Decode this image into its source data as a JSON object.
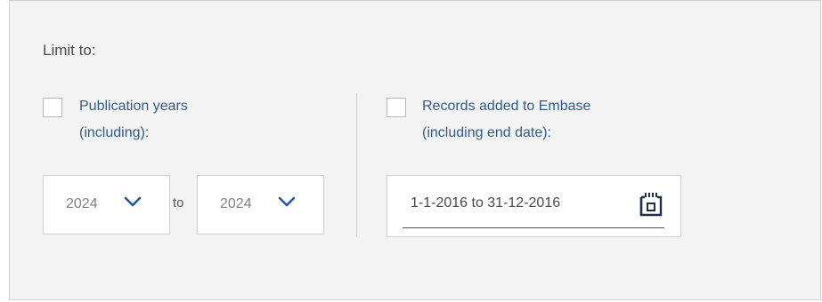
{
  "limit": {
    "title": "Limit to:"
  },
  "publication_years": {
    "label_line1": "Publication years",
    "label_line2": "(including):",
    "checked": false,
    "from_value": "2024",
    "to_label": "to",
    "to_value": "2024",
    "chevron_icon": "chevron-down-icon"
  },
  "records_added": {
    "label_line1": "Records added to Embase",
    "label_line2": "(including end date):",
    "checked": false,
    "date_range_value": "1-1-2016 to 31-12-2016",
    "calendar_icon": "calendar-icon"
  },
  "colors": {
    "panel_bg": "#f3f3f3",
    "link_blue": "#2f5c8f",
    "chevron_blue": "#1f5b9c",
    "border": "#cfcfcf"
  }
}
